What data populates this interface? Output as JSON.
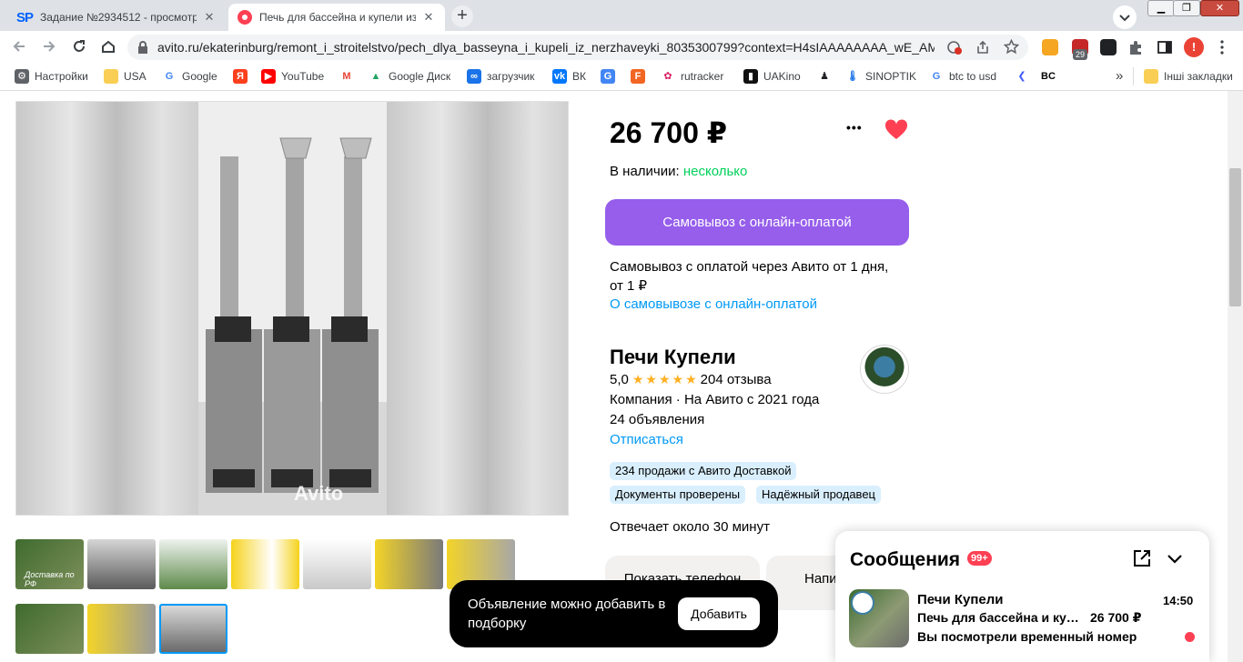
{
  "browser": {
    "tabs": [
      {
        "favicon": "SP",
        "title": "Задание №2934512 - просмотр"
      },
      {
        "title": "Печь для бассейна и купели из"
      }
    ],
    "new_tab": "+",
    "url": "avito.ru/ekaterinburg/remont_i_stroitelstvo/pech_dlya_basseyna_i_kupeli_iz_nerzhaveyki_8035300799?context=H4sIAAAAAAAA_wE_AMD...",
    "extension_badge": "29",
    "profile_initial": "!",
    "bookmarks": [
      {
        "label": "Настройки",
        "icon": "gear-icon"
      },
      {
        "label": "USA",
        "icon": "folder-icon"
      },
      {
        "label": "Google",
        "icon": "google-icon"
      },
      {
        "label": "",
        "icon": "yandex-icon",
        "glyph": "Я"
      },
      {
        "label": "YouTube",
        "icon": "youtube-icon"
      },
      {
        "label": "",
        "icon": "gmail-icon",
        "glyph": "M"
      },
      {
        "label": "Google Диск",
        "icon": "drive-icon"
      },
      {
        "label": "загрузчик",
        "icon": "loop-icon",
        "glyph": "∞"
      },
      {
        "label": "ВК",
        "icon": "vk-icon",
        "glyph": "vk"
      },
      {
        "label": "",
        "icon": "translate-icon",
        "glyph": "G"
      },
      {
        "label": "",
        "icon": "f-icon",
        "glyph": "F"
      },
      {
        "label": "rutracker",
        "icon": "rutracker-icon"
      },
      {
        "label": "UAKino",
        "icon": "uakino-icon"
      },
      {
        "label": "",
        "icon": "figure-icon"
      },
      {
        "label": "SINOPTIK",
        "icon": "thermometer-icon"
      },
      {
        "label": "btc to usd",
        "icon": "google-icon"
      },
      {
        "label": "",
        "icon": "bolt-icon"
      },
      {
        "label": "",
        "icon": "bc-icon",
        "glyph": "BC"
      }
    ],
    "more_bookmarks": "»",
    "other_bookmarks": "Інші закладки"
  },
  "gallery": {
    "watermark": "Avito",
    "thumbnails_row1": [
      "Доставка по РФ",
      "",
      "",
      "",
      "",
      "",
      "",
      ""
    ],
    "thumbnails_row2": [
      "",
      "",
      ""
    ],
    "selected_thumbnail": 10
  },
  "offer": {
    "price": "26 700 ₽",
    "stock_label": "В наличии:",
    "stock_value": "несколько",
    "more_menu": "•••",
    "buy_button": "Самовывоз с онлайн-оплатой",
    "pickup_text": "Самовывоз с оплатой через Авито от 1 дня, от 1 ₽",
    "pickup_link": "О самовывозе с онлайн-оплатой"
  },
  "seller": {
    "name": "Печи Купели",
    "rating": "5,0",
    "stars": 5,
    "reviews": "204 отзыва",
    "company_line": "Компания · На Авито с 2021 года",
    "ad_count": "24 объявления",
    "unsubscribe": "Отписаться",
    "badges": [
      "234 продажи с Авито Доставкой",
      "Документы проверены",
      "Надёжный продавец"
    ],
    "reply_time": "Отвечает около 30 минут",
    "show_phone": "Показать телефон",
    "write": "Написать"
  },
  "toast": {
    "text": "Объявление можно добавить в подборку",
    "button": "Добавить"
  },
  "messages": {
    "title": "Сообщения",
    "badge": "99+",
    "chat": {
      "name": "Печи Купели",
      "subject": "Печь для бассейна и купели из нержавейки",
      "price": "26 700 ₽",
      "time": "14:50",
      "preview": "Вы посмотрели временный номер"
    }
  },
  "colors": {
    "accent_purple": "#965eeb",
    "link_blue": "#0099f7",
    "stock_green": "#02d15c",
    "favorite_red": "#ff4053",
    "badge_blue": "#d9effd"
  }
}
